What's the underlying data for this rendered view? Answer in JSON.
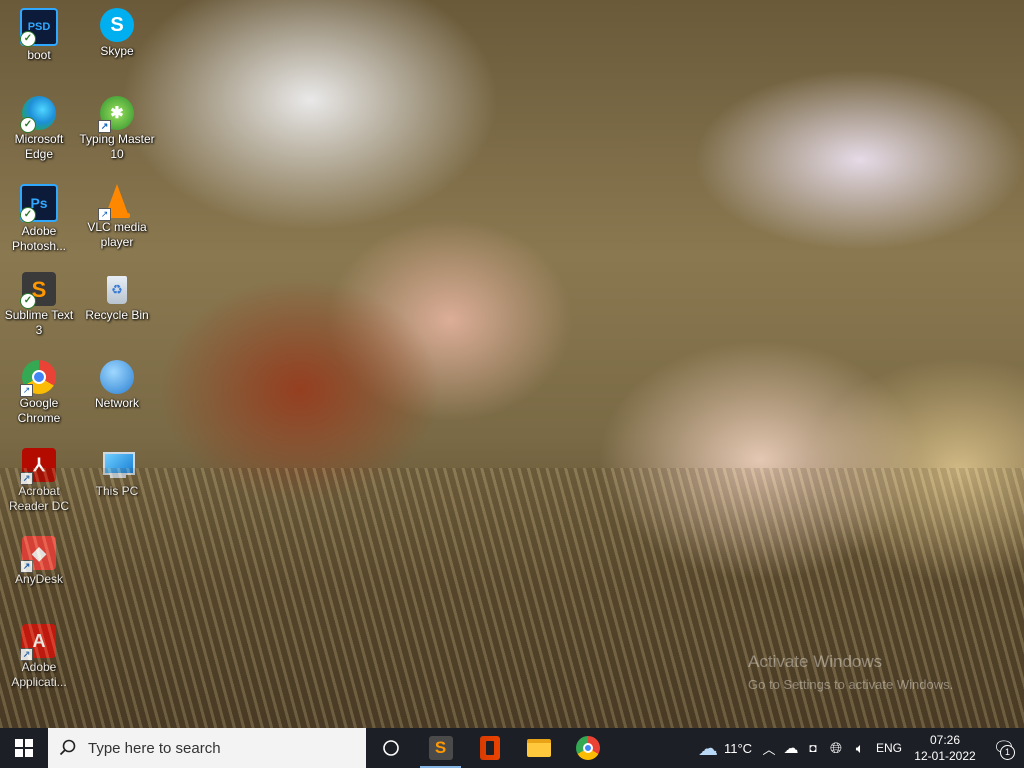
{
  "desktop_icons": [
    {
      "label": "boot",
      "icon": "photoshop-file-icon"
    },
    {
      "label": "Skype",
      "icon": "skype-icon"
    },
    {
      "label": "Microsoft Edge",
      "icon": "edge-icon"
    },
    {
      "label": "Typing Master 10",
      "icon": "typing-master-icon"
    },
    {
      "label": "Adobe Photosh...",
      "icon": "photoshop-icon"
    },
    {
      "label": "VLC media player",
      "icon": "vlc-icon"
    },
    {
      "label": "Sublime Text 3",
      "icon": "sublime-icon"
    },
    {
      "label": "Recycle Bin",
      "icon": "recycle-bin-icon"
    },
    {
      "label": "Google Chrome",
      "icon": "chrome-icon"
    },
    {
      "label": "Network",
      "icon": "network-icon"
    },
    {
      "label": "Acrobat Reader DC",
      "icon": "acrobat-icon"
    },
    {
      "label": "This PC",
      "icon": "this-pc-icon"
    },
    {
      "label": "AnyDesk",
      "icon": "anydesk-icon"
    },
    {
      "label": "Adobe Applicati...",
      "icon": "adobe-app-icon"
    }
  ],
  "watermark": {
    "title": "Activate Windows",
    "subtitle": "Go to Settings to activate Windows."
  },
  "taskbar": {
    "search_placeholder": "Type here to search",
    "pinned": [
      "task-view-icon",
      "sublime-icon",
      "office-icon",
      "file-explorer-icon",
      "chrome-icon"
    ],
    "weather": {
      "temp": "11°C",
      "icon": "cloud-icon"
    },
    "language": "ENG",
    "time": "07:26",
    "date": "12-01-2022",
    "notifications_count": "1"
  },
  "colors": {
    "taskbar_bg": "#1c1f25",
    "search_bg": "#f3f3f3",
    "active_indicator": "#86b6e6"
  }
}
